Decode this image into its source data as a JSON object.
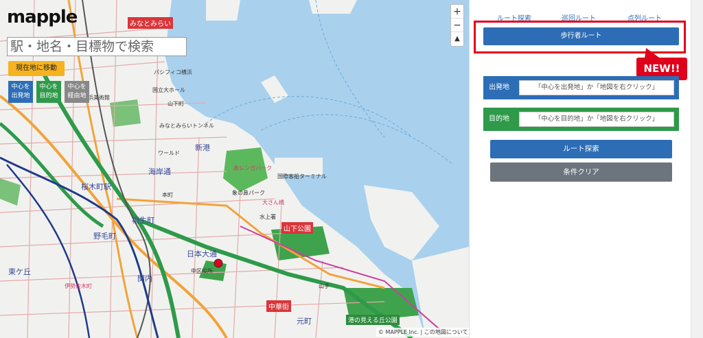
{
  "map": {
    "logo_text": "mapple",
    "search_placeholder": "駅・地名・目標物で検索",
    "locate_button": "現在地に移動",
    "mode_buttons": {
      "start": "中心を\n出発地",
      "destination": "中心を\n目的地",
      "via": "中心を\n経由地"
    },
    "zoom_in": "+",
    "zoom_out": "−",
    "compass": "▲",
    "copyright": "© MAPPLE Inc. | この地図について",
    "labels": {
      "minatomirai": "みなとみらい",
      "pacifico": "パシフィコ横浜",
      "kokusai_hall": "国立大ホール",
      "minatomirai_tunnel": "みなとみらいトンネル",
      "shinko": "新港",
      "kaigan_dori": "海岸通",
      "honcho": "本町",
      "sakuragi": "桜木町",
      "yamashita_park": "山下公園",
      "nihon_odori": "日本大通",
      "aioi": "相生町",
      "chuka": "中華街",
      "port_view_park": "港の見える丘公園",
      "motomachi": "元町",
      "naka_office": "中区役所",
      "kokusai_terminal": "国際客船ターミナル",
      "zou_no_hana": "象の鼻パーク",
      "akarenga": "赤レンガパーク",
      "osanbashi": "大さん橋",
      "noge": "野毛町",
      "isezaki": "伊勢佐木町",
      "higashigaoka": "東ケ丘",
      "yamashita": "山下町",
      "kannai": "関内",
      "hikawa": "水上署",
      "sakuragi_north": "桜木町駅",
      "yokohama_museum": "横浜美術館",
      "world_porters": "ワールド",
      "yamate": "山手"
    }
  },
  "panel": {
    "tabs": [
      "ルート探索",
      "巡回ルート",
      "点列ルート"
    ],
    "pedestrian_button": "歩行者ルート",
    "new_badge": "NEW!!",
    "origin_label": "出発地",
    "origin_placeholder": "「中心を出発地」か「地図を右クリック」",
    "destination_label": "目的地",
    "destination_placeholder": "「中心を目的地」か「地図を右クリック」",
    "search_button": "ルート探索",
    "clear_button": "条件クリア"
  },
  "colors": {
    "primary_blue": "#2d6db5",
    "destination_green": "#2e9a4a",
    "highlight_red": "#e0001b",
    "clear_gray": "#6c757d",
    "locate_orange": "#f5b320",
    "sea_blue": "#a9d1ee"
  }
}
